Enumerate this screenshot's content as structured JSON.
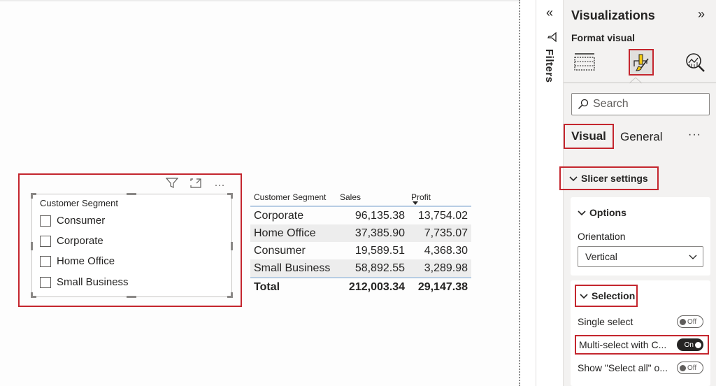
{
  "slicer": {
    "title": "Customer Segment",
    "items": [
      "Consumer",
      "Corporate",
      "Home Office",
      "Small Business"
    ],
    "header_icons": [
      "filter-icon",
      "focus-mode-icon",
      "more-options-icon"
    ],
    "more_label": "···"
  },
  "table": {
    "columns": [
      "Customer Segment",
      "Sales",
      "Profit"
    ],
    "sorted_column": "Profit",
    "rows": [
      [
        "Corporate",
        "96,135.38",
        "13,754.02"
      ],
      [
        "Home Office",
        "37,385.90",
        "7,735.07"
      ],
      [
        "Consumer",
        "19,589.51",
        "4,368.30"
      ],
      [
        "Small Business",
        "58,892.55",
        "3,289.98"
      ]
    ],
    "total": [
      "Total",
      "212,003.34",
      "29,147.38"
    ]
  },
  "filters_pane": {
    "collapse_icon": "«",
    "label": "Filters"
  },
  "viz_pane": {
    "title": "Visualizations",
    "expand_icon": "»",
    "format_label": "Format visual",
    "search_placeholder": "Search",
    "tabs": {
      "visual": "Visual",
      "general": "General",
      "more": "···"
    },
    "slicer_settings": "Slicer settings",
    "options": {
      "heading": "Options",
      "orientation_label": "Orientation",
      "orientation_value": "Vertical"
    },
    "selection": {
      "heading": "Selection",
      "toggles": [
        {
          "label": "Single select",
          "state": "Off"
        },
        {
          "label": "Multi-select with C...",
          "state": "On"
        },
        {
          "label": "Show \"Select all\" o...",
          "state": "Off"
        }
      ]
    }
  },
  "colors": {
    "highlight": "#c4262e",
    "table_rule": "#b7cde4",
    "format_icon_yellow": "#f2c811"
  }
}
